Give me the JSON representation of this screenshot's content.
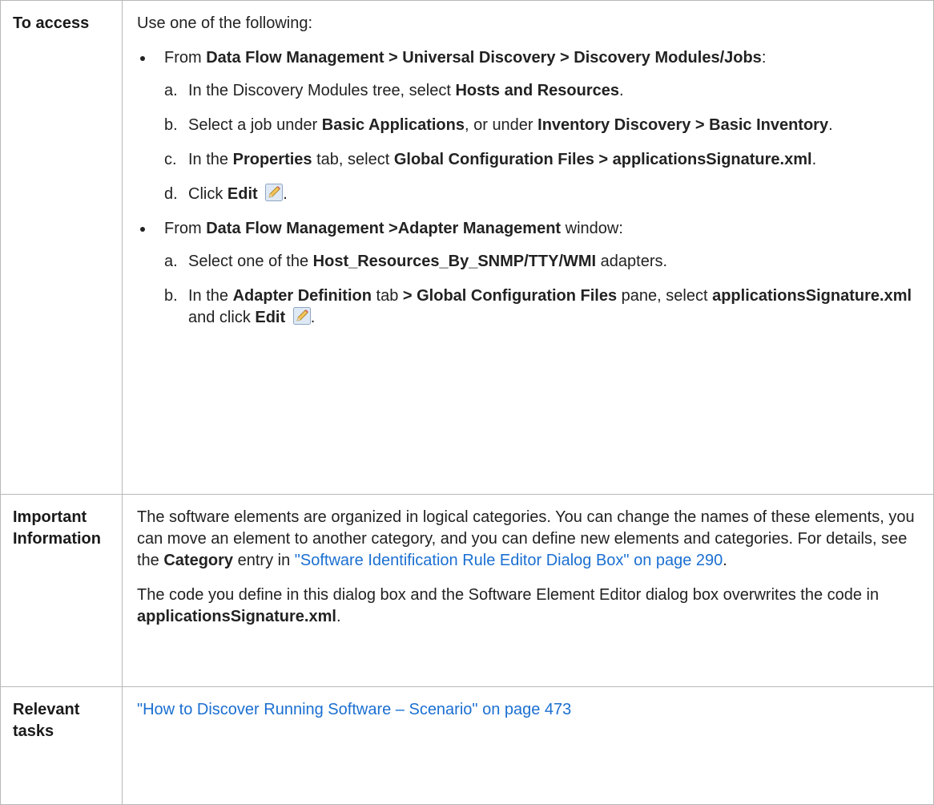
{
  "access": {
    "header": "To access",
    "intro": "Use one of the following:",
    "option1": {
      "pre": "From ",
      "path": "Data Flow Management > Universal Discovery > Discovery Modules/Jobs",
      "post": ":",
      "step_a": {
        "marker": "a.",
        "t1": "In the Discovery Modules tree, select ",
        "b1": "Hosts and Resources",
        "t2": "."
      },
      "step_b": {
        "marker": "b.",
        "t1": "Select a job under ",
        "b1": "Basic Applications",
        "t2": ", or under ",
        "b2": "Inventory Discovery > Basic Inventory",
        "t3": "."
      },
      "step_c": {
        "marker": "c.",
        "t1": "In the ",
        "b1": "Properties",
        "t2": " tab, select ",
        "b2": "Global Configuration Files > applicationsSignature.xml",
        "t3": "."
      },
      "step_d": {
        "marker": "d.",
        "t1": "Click ",
        "b1": "Edit",
        "t2": ".",
        "icon": "edit-pencil-icon"
      }
    },
    "option2": {
      "pre": "From ",
      "path": "Data Flow Management >Adapter Management",
      "post": " window:",
      "step_a": {
        "marker": "a.",
        "t1": "Select one of the ",
        "b1": "Host_Resources_By_SNMP/TTY/WMI",
        "t2": " adapters."
      },
      "step_b": {
        "marker": "b.",
        "t1": "In the ",
        "b1": "Adapter Definition",
        "t2": " tab ",
        "b2": "> Global Configuration Files",
        "t3": " pane, select ",
        "b3": "applicationsSignature.xml",
        "t4": " and click ",
        "b4": "Edit",
        "t5": ".",
        "icon": "edit-pencil-icon"
      }
    }
  },
  "important": {
    "header": "Important Information",
    "para1": {
      "t1": "The software elements are organized in logical categories. You can change the names of these elements, you can move an element to another category, and you can define new elements and categories. For details, see the ",
      "b1": "Category",
      "t2": " entry in ",
      "link": "\"Software Identification Rule Editor Dialog Box\" on page 290",
      "t3": "."
    },
    "para2": {
      "t1": "The code you define in this dialog box and the Software Element Editor dialog box overwrites the code in ",
      "b1": "applicationsSignature.xml",
      "t2": "."
    }
  },
  "tasks": {
    "header": "Relevant tasks",
    "link": "\"How to Discover Running Software – Scenario\" on page 473"
  },
  "colors": {
    "link": "#1b6fd1",
    "border": "#b8b8b8",
    "text": "#222222"
  }
}
